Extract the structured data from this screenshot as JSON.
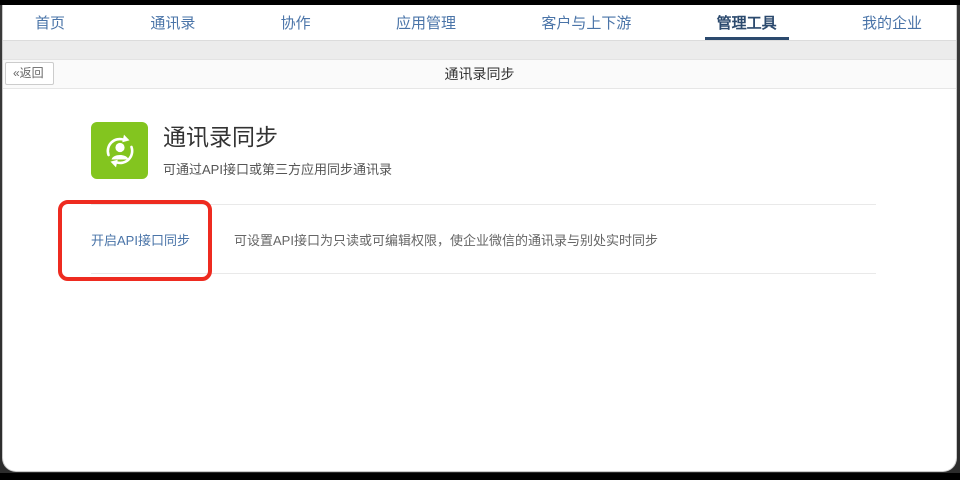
{
  "nav": {
    "items": [
      {
        "label": "首页",
        "active": false
      },
      {
        "label": "通讯录",
        "active": false
      },
      {
        "label": "协作",
        "active": false
      },
      {
        "label": "应用管理",
        "active": false
      },
      {
        "label": "客户与上下游",
        "active": false
      },
      {
        "label": "管理工具",
        "active": true
      },
      {
        "label": "我的企业",
        "active": false
      }
    ],
    "active_color": "#2c4a6e",
    "link_color": "#4a74a8"
  },
  "subheader": {
    "back_label": "«返回",
    "title": "通讯录同步"
  },
  "hero": {
    "icon": "contact-sync-icon",
    "icon_color": "#83c51f",
    "title": "通讯录同步",
    "subtitle": "可通过API接口或第三方应用同步通讯录"
  },
  "settings": {
    "rows": [
      {
        "link": "开启API接口同步",
        "description": "可设置API接口为只读或可编辑权限，使企业微信的通讯录与别处实时同步"
      }
    ]
  },
  "annotation": {
    "type": "red-highlight-box",
    "color": "#ee2b20",
    "target": "开启API接口同步"
  }
}
